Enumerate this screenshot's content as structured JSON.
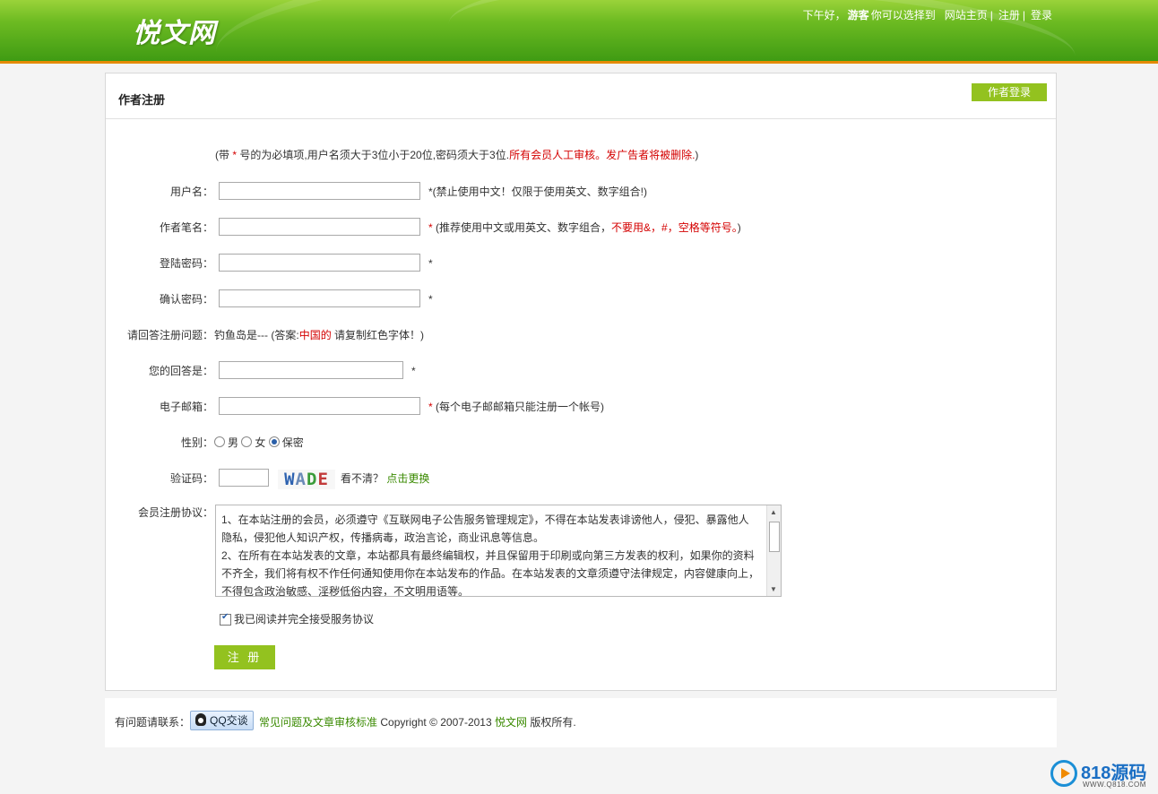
{
  "header": {
    "logo": "悦文网",
    "greeting": "下午好，",
    "guest": "游客",
    "choose": "你可以选择到",
    "home_link": "网站主页",
    "register_link": "注册",
    "login_link": "登录",
    "bg_color": "#6dbb22",
    "accent_line": "#e58a00"
  },
  "panel": {
    "title": "作者注册",
    "author_login_btn": "作者登录",
    "notice_prefix": "(带",
    "notice_star": "*",
    "notice_mid": "号的为必填项,用户名须大于3位小于20位,密码须大于3位.",
    "notice_red": "所有会员人工审核。发广告者将被删除.",
    "notice_suffix": ")"
  },
  "form": {
    "username": {
      "label": "用户名：",
      "value": "",
      "hint": "*(禁止使用中文！仅限于使用英文、数字组合!)"
    },
    "penname": {
      "label": "作者笔名：",
      "value": "",
      "hint_star": "*",
      "hint_a": "(推荐使用中文或用英文、数字组合，",
      "hint_red": "不要用&，#，空格等符号。",
      "hint_b": ")"
    },
    "password": {
      "label": "登陆密码：",
      "value": "",
      "star": "*"
    },
    "confirm": {
      "label": "确认密码：",
      "value": "",
      "star": "*"
    },
    "question": {
      "label": "请回答注册问题：",
      "text": "钓鱼岛是---",
      "answer_a": "(答案:",
      "answer_red": "中国的",
      "answer_b": "请复制红色字体！)"
    },
    "answer": {
      "label": "您的回答是：",
      "value": "",
      "star": "*"
    },
    "email": {
      "label": "电子邮箱：",
      "value": "",
      "star": "*",
      "hint": "(每个电子邮邮箱只能注册一个帐号)"
    },
    "gender": {
      "label": "性别：",
      "options": [
        "男",
        "女",
        "保密"
      ],
      "selected": "保密"
    },
    "captcha": {
      "label": "验证码：",
      "value": "",
      "image_text": "WADE",
      "unclear": "看不清？",
      "refresh": "点击更换"
    },
    "agreement": {
      "label": "会员注册协议：",
      "text": "1、在本站注册的会员，必须遵守《互联网电子公告服务管理规定》，不得在本站发表诽谤他人，侵犯、暴露他人隐私，侵犯他人知识产权，传播病毒，政治言论，商业讯息等信息。\n2、在所有在本站发表的文章，本站都具有最终编辑权，并且保留用于印刷或向第三方发表的权利，如果你的资料不齐全，我们将有权不作任何通知使用你在本站发布的作品。在本站发表的文章须遵守法律规定，内容健康向上，不得包含政治敏感、淫秽低俗内容，不文明用语等。"
    },
    "agree_checkbox": {
      "label": "我已阅读并完全接受服务协议",
      "checked": true
    },
    "submit": "注 册"
  },
  "footer": {
    "contact": "有问题请联系：",
    "qq_btn": "QQ交谈",
    "faq_link": "常见问题及文章审核标准",
    "copyright": "Copyright © 2007-2013",
    "site_link": "悦文网",
    "rights": "版权所有."
  },
  "watermark": {
    "text": "818源码",
    "sub": "WWW.Q818.COM"
  }
}
